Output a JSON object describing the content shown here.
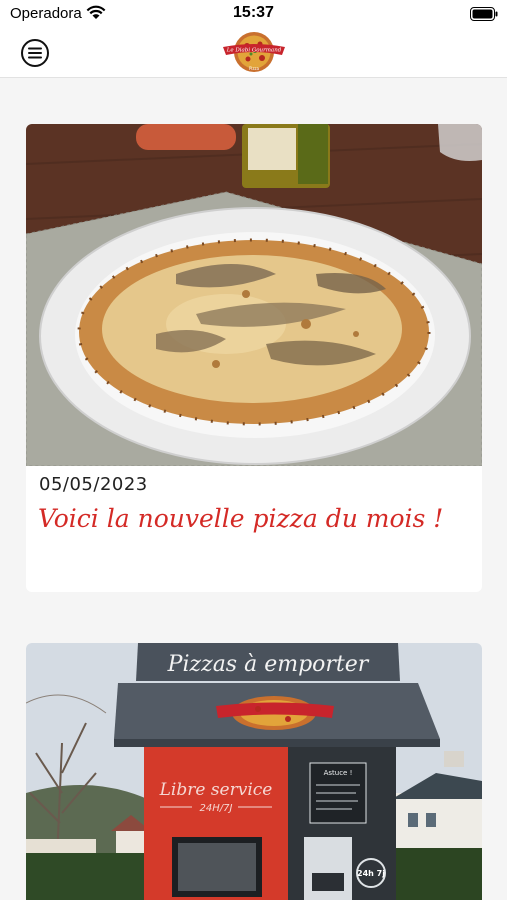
{
  "status_bar": {
    "carrier": "Operadora",
    "time": "15:37"
  },
  "nav": {
    "menu_icon": "menu-circle-icon",
    "logo_text_top": "Le Diabi Gourmand",
    "logo_text_bottom": "Pizza"
  },
  "feed": {
    "posts": [
      {
        "date": "05/05/2023",
        "title": "Voici la nouvelle pizza du mois !"
      },
      {
        "sign_text": "Pizzas à emporter",
        "panel_text": "Libre service",
        "panel_hours": "24H/7J",
        "board_title": "Astuce !",
        "badge_text": "24h 7j"
      }
    ]
  },
  "colors": {
    "accent": "#d42a26",
    "background": "#f5f5f5"
  }
}
